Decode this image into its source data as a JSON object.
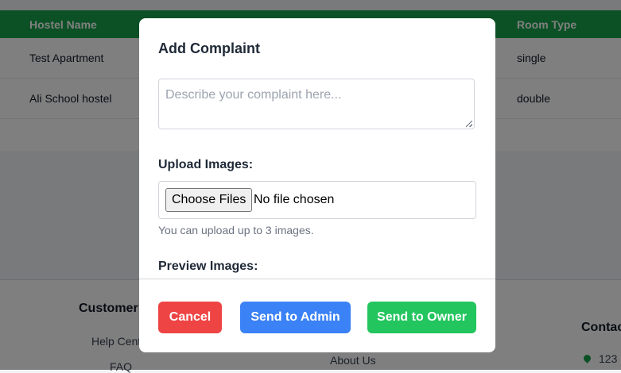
{
  "table": {
    "headers": [
      "Hostel Name",
      "Room Type"
    ],
    "rows": [
      {
        "hostel_name": "Test Apartment",
        "room_type": "single"
      },
      {
        "hostel_name": "Ali School hostel",
        "room_type": "double"
      }
    ]
  },
  "footer": {
    "col1_heading": "Customer S",
    "col1_links": [
      "Help Cent",
      "FAQ"
    ],
    "col2_links": [
      "About Us"
    ],
    "col3_heading": "Contac",
    "col3_address": "123"
  },
  "modal": {
    "title": "Add Complaint",
    "complaint_placeholder": "Describe your complaint here...",
    "upload_label": "Upload Images:",
    "choose_files_label": "Choose Files",
    "file_status": "No file chosen",
    "upload_hint": "You can upload up to 3 images.",
    "preview_label": "Preview Images:",
    "cancel_label": "Cancel",
    "send_admin_label": "Send to Admin",
    "send_owner_label": "Send to Owner"
  },
  "colors": {
    "header_green": "#16a34a",
    "cancel_red": "#ef4444",
    "admin_blue": "#3b82f6",
    "owner_green": "#22c55e"
  }
}
